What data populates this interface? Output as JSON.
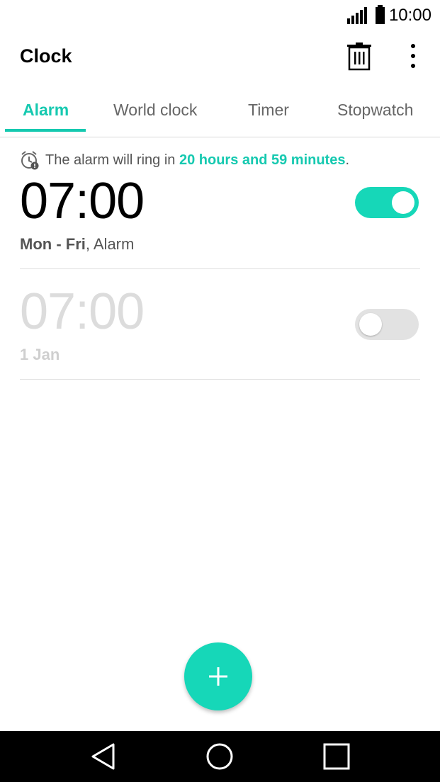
{
  "status_bar": {
    "time": "10:00",
    "signal_icon": "signal-icon",
    "battery_icon": "battery-icon"
  },
  "app_bar": {
    "title": "Clock",
    "delete_icon": "trash-icon",
    "more_icon": "more-vert-icon"
  },
  "tabs": [
    {
      "label": "Alarm",
      "active": true
    },
    {
      "label": "World clock",
      "active": false
    },
    {
      "label": "Timer",
      "active": false
    },
    {
      "label": "Stopwatch",
      "active": false
    }
  ],
  "info": {
    "prefix": "The alarm will ring in ",
    "highlight": "20 hours and 59 minutes",
    "suffix": ".",
    "icon": "alarm-clock-icon"
  },
  "alarms": [
    {
      "time": "07:00",
      "days": "Mon - Fri",
      "label": ", Alarm",
      "enabled": true
    },
    {
      "time": "07:00",
      "date": "1 Jan",
      "enabled": false
    }
  ],
  "fab": {
    "icon": "plus-icon"
  },
  "nav": {
    "back_icon": "back-icon",
    "home_icon": "home-icon",
    "recents_icon": "recents-icon"
  },
  "colors": {
    "accent": "#16c9b0",
    "toggle_on": "#16d7b8",
    "toggle_off": "#e2e2e2",
    "nav_bg": "#000000"
  }
}
